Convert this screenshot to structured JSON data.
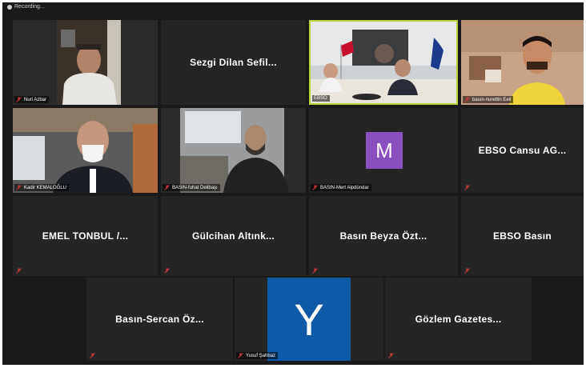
{
  "recording": {
    "label": "Recording..."
  },
  "colors": {
    "tile_bg": "#252525",
    "active_border": "#b7d43a",
    "muted_mic": "#d23a3a"
  },
  "tiles": [
    {
      "name": "Nuri Azbar",
      "type": "video"
    },
    {
      "name": "Sezgi Dilan Sefil...",
      "type": "name"
    },
    {
      "name": "EBSO",
      "type": "video",
      "active": true
    },
    {
      "name": "basın-nurettin Eeil",
      "type": "video"
    },
    {
      "name": "Kadir KEMALOĞLU",
      "type": "video"
    },
    {
      "name": "BASIN-fuhat Delibaşı",
      "type": "video"
    },
    {
      "name": "BASIN-Mert Alpdündar",
      "type": "avatar",
      "initial": "M",
      "avatar_color": "#8a4fbf"
    },
    {
      "name": "EBSO Cansu AG...",
      "type": "name"
    },
    {
      "name": "EMEL TONBUL /...",
      "type": "name"
    },
    {
      "name": "Gülcihan Altınk...",
      "type": "name"
    },
    {
      "name": "Basın Beyza Özt...",
      "type": "name"
    },
    {
      "name": "EBSO Basın",
      "type": "name"
    },
    {
      "name": "Basın-Sercan Öz...",
      "type": "name"
    },
    {
      "name": "Yusuf Şahbaz",
      "type": "avatar",
      "initial": "Y",
      "avatar_color": "#0e5aa7"
    },
    {
      "name": "Gözlem Gazetes...",
      "type": "name"
    }
  ]
}
